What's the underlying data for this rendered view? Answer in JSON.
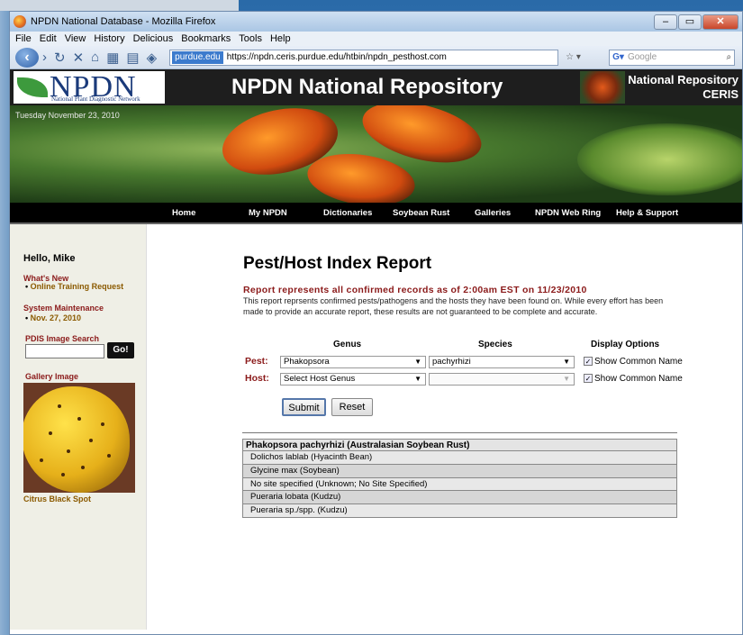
{
  "window": {
    "title": "NPDN National Database - Mozilla Firefox"
  },
  "menu": [
    "File",
    "Edit",
    "View",
    "History",
    "Delicious",
    "Bookmarks",
    "Tools",
    "Help"
  ],
  "urlbar": {
    "site": "purdue.edu",
    "url": "https://npdn.ceris.purdue.edu/htbin/npdn_pesthost.com"
  },
  "search": {
    "placeholder": "Google"
  },
  "header": {
    "logo": "NPDN",
    "logo_sub": "National Plant Diagnostic Network",
    "title": "NPDN National Repository",
    "right_line1": "National Repository",
    "right_line2": "CERIS"
  },
  "banner": {
    "date": "Tuesday November 23, 2010"
  },
  "nav": [
    {
      "label": "Home"
    },
    {
      "label": "My NPDN"
    },
    {
      "label": "Dictionaries"
    },
    {
      "label": "Soybean Rust"
    },
    {
      "label": "Galleries"
    },
    {
      "label": "NPDN Web Ring"
    },
    {
      "label": "Help & Support"
    }
  ],
  "sidebar": {
    "hello": "Hello, Mike",
    "whats_new": "What's New",
    "whats_new_item": "Online Training Request",
    "maint": "System Maintenance",
    "maint_item": "Nov. 27, 2010",
    "pdis": "PDIS Image Search",
    "go": "Go!",
    "gallery": "Gallery Image",
    "gallery_caption": "Citrus Black Spot"
  },
  "main": {
    "title": "Pest/Host Index Report",
    "report_line": "Report represents all confirmed records as of 2:00am EST on 11/23/2010",
    "description": "This report reprsents confirmed pests/pathogens and the hosts they have been found on.  While every effort has been made to provide an accurate report, these results are not guaranteed to be complete and accurate.",
    "col_genus": "Genus",
    "col_species": "Species",
    "col_display": "Display Options",
    "pest_label": "Pest:",
    "pest_genus": "Phakopsora",
    "pest_species": "pachyrhizi",
    "host_label": "Host:",
    "host_genus": "Select Host Genus",
    "host_species": "",
    "show_common": "Show Common Name",
    "submit": "Submit",
    "reset": "Reset"
  },
  "results": {
    "header": "Phakopsora pachyrhizi (Australasian Soybean Rust)",
    "rows": [
      "Dolichos lablab (Hyacinth Bean)",
      "Glycine max (Soybean)",
      "No site specified (Unknown; No Site Specified)",
      "Pueraria lobata (Kudzu)",
      "Pueraria sp./spp. (Kudzu)"
    ]
  }
}
